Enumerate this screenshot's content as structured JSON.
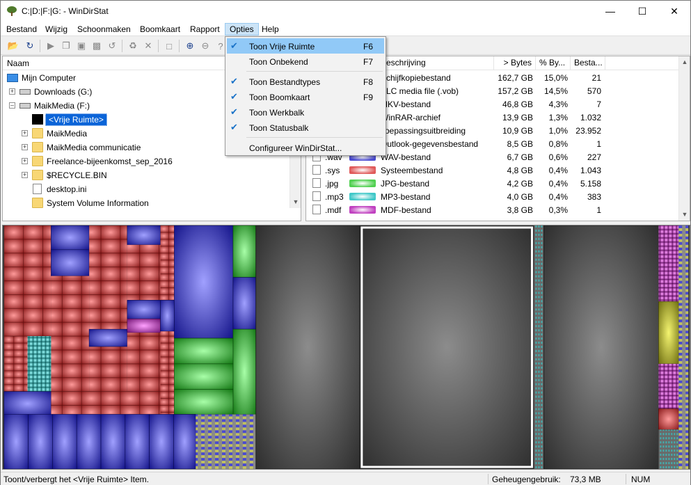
{
  "window": {
    "title": "C:|D:|F:|G: - WinDirStat"
  },
  "menubar": [
    "Bestand",
    "Wijzig",
    "Schoonmaken",
    "Boomkaart",
    "Rapport",
    "Opties",
    "Help"
  ],
  "options_menu": {
    "items": [
      {
        "label": "Toon Vrije Ruimte",
        "shortcut": "F6",
        "checked": true,
        "highlighted": true
      },
      {
        "label": "Toon Onbekend",
        "shortcut": "F7",
        "checked": false
      },
      {
        "label": "Toon Bestandtypes",
        "shortcut": "F8",
        "checked": true
      },
      {
        "label": "Toon Boomkaart",
        "shortcut": "F9",
        "checked": true
      },
      {
        "label": "Toon Werkbalk",
        "shortcut": "",
        "checked": true
      },
      {
        "label": "Toon Statusbalk",
        "shortcut": "",
        "checked": true
      },
      {
        "label": "Configureer WinDirStat...",
        "shortcut": "",
        "checked": false
      }
    ]
  },
  "tree": {
    "header": "Naam",
    "rows": [
      {
        "label": "Mijn Computer",
        "icon": "computer-icon"
      },
      {
        "label": "Downloads (G:)",
        "icon": "drive-icon"
      },
      {
        "label": "MaikMedia (F:)",
        "icon": "drive-icon"
      },
      {
        "label": "<Vrije Ruimte>",
        "icon": "free-space-icon",
        "selected": true
      },
      {
        "label": "MaikMedia",
        "icon": "folder-icon"
      },
      {
        "label": "MaikMedia communicatie",
        "icon": "folder-icon"
      },
      {
        "label": "Freelance-bijeenkomst_sep_2016",
        "icon": "folder-icon"
      },
      {
        "label": "$RECYCLE.BIN",
        "icon": "folder-icon"
      },
      {
        "label": "desktop.ini",
        "icon": "file-icon"
      },
      {
        "label": "System Volume Information",
        "icon": "folder-icon"
      }
    ]
  },
  "extensions": {
    "headers": [
      "Beschrijving",
      "> Bytes",
      "% By...",
      "Besta..."
    ],
    "rows": [
      {
        "ext": "",
        "desc": "Schijfkopiebestand",
        "bytes": "162,7 GB",
        "pct": "15,0%",
        "count": "21",
        "color": "#3030c8"
      },
      {
        "ext": "",
        "desc": "VLC media file (.vob)",
        "bytes": "157,2 GB",
        "pct": "14,5%",
        "count": "570",
        "color": "#d03030"
      },
      {
        "ext": "",
        "desc": "MKV-bestand",
        "bytes": "46,8 GB",
        "pct": "4,3%",
        "count": "7",
        "color": "#30b030"
      },
      {
        "ext": "",
        "desc": "WinRAR-archief",
        "bytes": "13,9 GB",
        "pct": "1,3%",
        "count": "1.032",
        "color": "#3030c8"
      },
      {
        "ext": "",
        "desc": "Toepassingsuitbreiding",
        "bytes": "10,9 GB",
        "pct": "1,0%",
        "count": "23.952",
        "color": "#c030c0"
      },
      {
        "ext": "",
        "desc": "Outlook-gegevensbestand",
        "bytes": "8,5 GB",
        "pct": "0,8%",
        "count": "1",
        "color": "#20b0b0"
      },
      {
        "ext": ".wav",
        "desc": "WAV-bestand",
        "bytes": "6,7 GB",
        "pct": "0,6%",
        "count": "227",
        "color": "#4a4ad0"
      },
      {
        "ext": ".sys",
        "desc": "Systeembestand",
        "bytes": "4,8 GB",
        "pct": "0,4%",
        "count": "1.043",
        "color": "#e05a5a"
      },
      {
        "ext": ".jpg",
        "desc": "JPG-bestand",
        "bytes": "4,2 GB",
        "pct": "0,4%",
        "count": "5.158",
        "color": "#50d050"
      },
      {
        "ext": ".mp3",
        "desc": "MP3-bestand",
        "bytes": "4,0 GB",
        "pct": "0,4%",
        "count": "383",
        "color": "#40c8c8"
      },
      {
        "ext": ".mdf",
        "desc": "MDF-bestand",
        "bytes": "3,8 GB",
        "pct": "0,3%",
        "count": "1",
        "color": "#c040c0"
      }
    ]
  },
  "statusbar": {
    "text": "Toont/verbergt het <Vrije Ruimte> Item.",
    "mem_label": "Geheugengebruik:",
    "mem_value": "73,3 MB",
    "num": "NUM"
  }
}
